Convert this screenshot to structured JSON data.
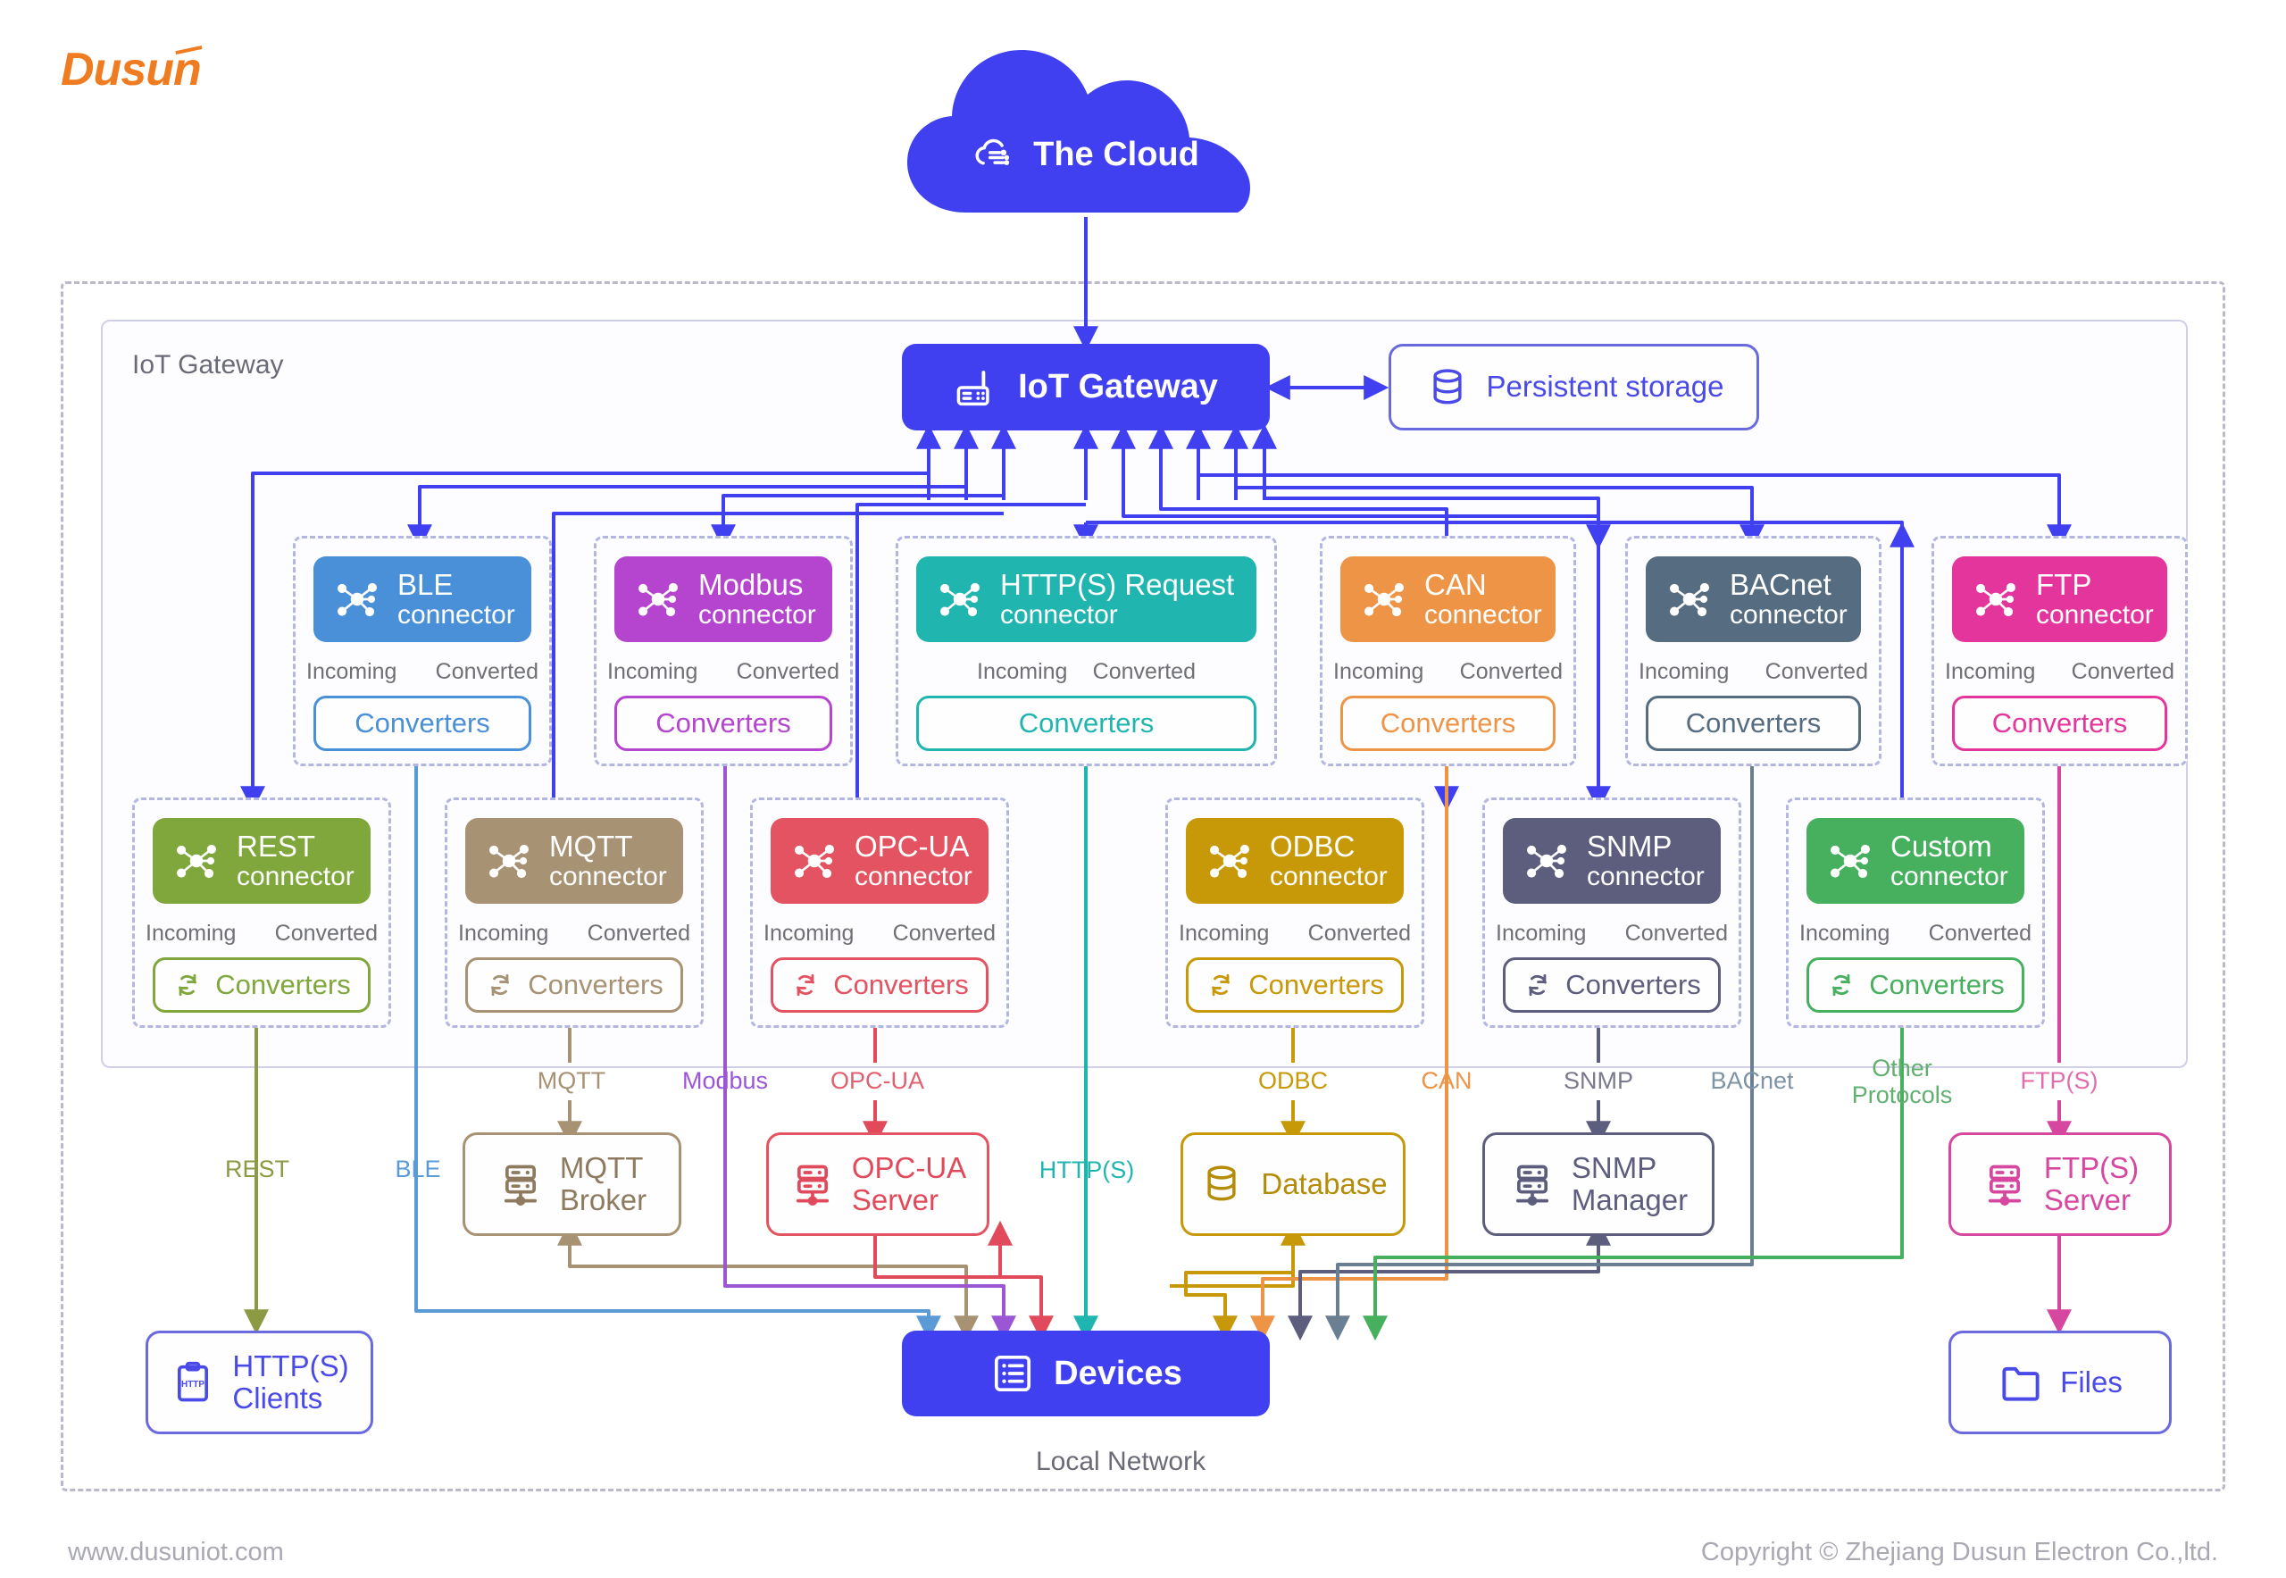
{
  "brand": {
    "logo_text": "Dusun"
  },
  "footer": {
    "left": "www.dusuniot.com",
    "right": "Copyright © Zhejiang Dusun Electron Co.,ltd."
  },
  "regions": {
    "gateway_label": "IoT Gateway",
    "local_network_label": "Local Network"
  },
  "cloud": {
    "label": "The Cloud",
    "icon": "cloud-iot-icon",
    "color": "#4040F0"
  },
  "gateway": {
    "label": "IoT Gateway",
    "icon": "router-icon",
    "color": "#4040F0"
  },
  "storage": {
    "label": "Persistent storage",
    "icon": "database-icon",
    "color": "#4A4AE8"
  },
  "devices": {
    "label": "Devices",
    "icon": "device-list-icon",
    "color": "#4040F0"
  },
  "io_labels": {
    "incoming": "Incoming",
    "converted": "Converted"
  },
  "converters_label": "Converters",
  "connectors_row1": [
    {
      "name": "BLE",
      "sub": "connector",
      "color": "#4A90D9",
      "icon": "hub-icon",
      "converters_icon": null
    },
    {
      "name": "Modbus",
      "sub": "connector",
      "color": "#B545CE",
      "icon": "hub-icon",
      "converters_icon": null
    },
    {
      "name": "HTTP(S) Request",
      "sub": "connector",
      "color": "#21B5B0",
      "icon": "hub-icon",
      "converters_icon": null
    },
    {
      "name": "CAN",
      "sub": "connector",
      "color": "#EE9446",
      "icon": "hub-icon",
      "converters_icon": null
    },
    {
      "name": "BACnet",
      "sub": "connector",
      "color": "#566C80",
      "icon": "hub-icon",
      "converters_icon": null
    },
    {
      "name": "FTP",
      "sub": "connector",
      "color": "#E3359B",
      "icon": "hub-icon",
      "converters_icon": null
    }
  ],
  "connectors_row2": [
    {
      "name": "REST",
      "sub": "connector",
      "color": "#7FA73C",
      "icon": "hub-icon",
      "converters_icon": "sync-icon"
    },
    {
      "name": "MQTT",
      "sub": "connector",
      "color": "#A89274",
      "icon": "hub-icon",
      "converters_icon": "sync-icon"
    },
    {
      "name": "OPC-UA",
      "sub": "connector",
      "color": "#E45361",
      "icon": "hub-icon",
      "converters_icon": "sync-icon"
    },
    {
      "name": "ODBC",
      "sub": "connector",
      "color": "#C79908",
      "icon": "hub-icon",
      "converters_icon": "sync-icon"
    },
    {
      "name": "SNMP",
      "sub": "connector",
      "color": "#5D5D7E",
      "icon": "hub-icon",
      "converters_icon": "sync-icon"
    },
    {
      "name": "Custom",
      "sub": "connector",
      "color": "#47B05E",
      "icon": "hub-icon",
      "converters_icon": "sync-icon"
    }
  ],
  "protocol_labels": [
    {
      "text": "REST",
      "color": "#8C9A43"
    },
    {
      "text": "BLE",
      "color": "#5B9BD5"
    },
    {
      "text": "MQTT",
      "color": "#A89274"
    },
    {
      "text": "Modbus",
      "color": "#9B57D3"
    },
    {
      "text": "OPC-UA",
      "color": "#E06070"
    },
    {
      "text": "HTTP(S)",
      "color": "#21B5B0"
    },
    {
      "text": "ODBC",
      "color": "#C79908"
    },
    {
      "text": "CAN",
      "color": "#EE9446"
    },
    {
      "text": "SNMP",
      "color": "#7A7A8C"
    },
    {
      "text": "BACnet",
      "color": "#7E93A6"
    },
    {
      "text": "Other\nProtocols",
      "color": "#61B06F"
    },
    {
      "text": "FTP(S)",
      "color": "#E06DAE"
    }
  ],
  "endpoints": [
    {
      "label": "MQTT\nBroker",
      "line1": "MQTT",
      "line2": "Broker",
      "color": "#A89274",
      "icon": "server-icon"
    },
    {
      "label": "OPC-UA\nServer",
      "line1": "OPC-UA",
      "line2": "Server",
      "color": "#E45361",
      "icon": "server-icon"
    },
    {
      "label": "Database",
      "line1": "Database",
      "line2": "",
      "color": "#C79908",
      "icon": "database-icon"
    },
    {
      "label": "SNMP\nManager",
      "line1": "SNMP",
      "line2": "Manager",
      "color": "#5D5D7E",
      "icon": "server-icon"
    },
    {
      "label": "FTP(S)\nServer",
      "line1": "FTP(S)",
      "line2": "Server",
      "color": "#D6479F",
      "icon": "server-icon"
    }
  ],
  "bottom_nodes": [
    {
      "line1": "HTTP(S)",
      "line2": "Clients",
      "color": "#4A4AE8",
      "icon": "clipboard-http-icon",
      "icon_text": "HTTP"
    },
    {
      "line1": "Files",
      "line2": "",
      "color": "#4A4AE8",
      "icon": "folder-icon"
    }
  ]
}
